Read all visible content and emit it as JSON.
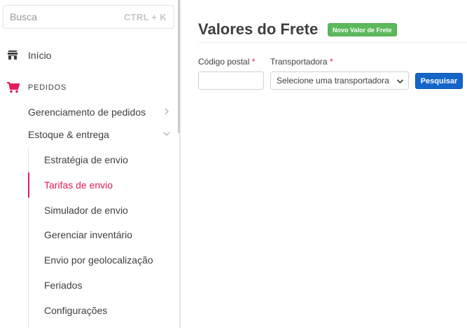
{
  "sidebar": {
    "search": {
      "placeholder": "Busca",
      "shortcut": "CTRL + K"
    },
    "home": {
      "label": "Início",
      "icon": "store-icon"
    },
    "section": {
      "label": "PEDIDOS",
      "icon": "cart-icon",
      "color": "#e31c58"
    },
    "items": [
      {
        "label": "Gerenciamento de pedidos",
        "state": "collapsed"
      },
      {
        "label": "Estoque & entrega",
        "state": "expanded"
      }
    ],
    "subitems": [
      {
        "label": "Estratégia de envio",
        "active": false
      },
      {
        "label": "Tarifas de envio",
        "active": true
      },
      {
        "label": "Simulador de envio",
        "active": false
      },
      {
        "label": "Gerenciar inventário",
        "active": false
      },
      {
        "label": "Envio por geolocalização",
        "active": false
      },
      {
        "label": "Feriados",
        "active": false
      },
      {
        "label": "Configurações",
        "active": false
      }
    ]
  },
  "main": {
    "title": "Valores do Frete",
    "new_button": "Novo Valor de Frete",
    "form": {
      "postal_label": "Código postal",
      "carrier_label": "Transportadora",
      "required_mark": "*",
      "postal_value": "",
      "carrier_selected": "Selecione uma transportadora",
      "search_button": "Pesquisar"
    }
  },
  "colors": {
    "accent": "#e31c58",
    "success": "#5cb85c",
    "primary": "#1465c8"
  }
}
